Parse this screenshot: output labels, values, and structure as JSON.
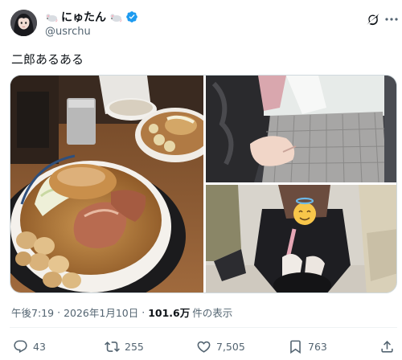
{
  "author": {
    "display_name": "にゅたん",
    "handle": "@usrchu",
    "verified": true,
    "avatar_icon": "user-avatar",
    "name_emoji_icon": "mouse-emoji-icon"
  },
  "post": {
    "text": "二郎あるある",
    "media": [
      {
        "icon": "ramen-photo"
      },
      {
        "icon": "person-torso-photo"
      },
      {
        "icon": "person-crouching-photo"
      }
    ]
  },
  "meta": {
    "time": "午後7:19",
    "date": "2026年1月10日",
    "separator": "·",
    "views_count": "101.6万",
    "views_label": "件の表示"
  },
  "actions": {
    "reply_count": "43",
    "repost_count": "255",
    "like_count": "7,505",
    "bookmark_count": "763"
  },
  "colors": {
    "text_primary": "#0f1419",
    "text_secondary": "#536471",
    "verified_blue": "#1d9bf0",
    "border": "#cfd9de"
  }
}
